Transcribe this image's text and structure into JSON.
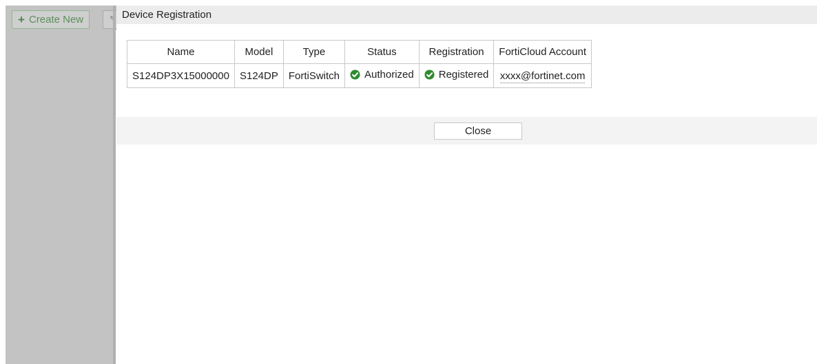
{
  "background": {
    "create_new_label": "Create New"
  },
  "dialog": {
    "title": "Device Registration",
    "table": {
      "headers": [
        "Name",
        "Model",
        "Type",
        "Status",
        "Registration",
        "FortiCloud Account"
      ],
      "rows": [
        {
          "name": "S124DP3X15000000",
          "model": "S124DP",
          "type": "FortiSwitch",
          "status": "Authorized",
          "registration": "Registered",
          "account": "xxxx@fortinet.com"
        }
      ]
    },
    "close_label": "Close"
  },
  "colors": {
    "accent_green": "#2e8b2e",
    "overlay_grey": "#c3c3c3"
  },
  "icons": {
    "status": "check-circle-icon",
    "registration": "check-circle-icon",
    "create_new": "plus-icon",
    "edit": "pencil-icon"
  }
}
